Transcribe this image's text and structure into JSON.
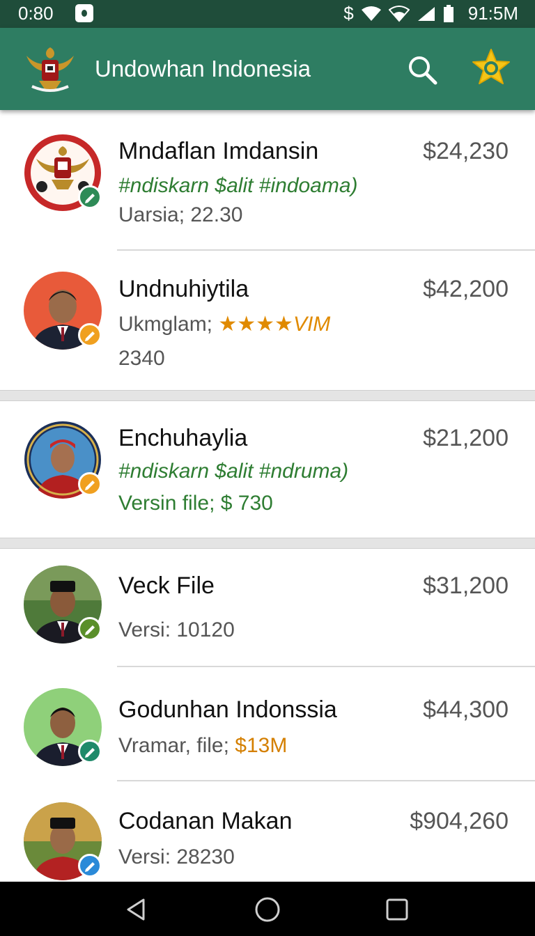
{
  "status_bar": {
    "time": "0:80",
    "dollar_glyph": "$",
    "clock": "91:5M",
    "icons": [
      "notification-icon",
      "dollar-icon",
      "wifi-icon",
      "signal-icon",
      "battery-icon"
    ]
  },
  "app_bar": {
    "title": "Undowhan Indonesia",
    "icons": [
      "garuda-logo-icon",
      "search-icon",
      "star-icon"
    ],
    "colors": {
      "app_bar": "#2e7d62",
      "status_bar": "#1f4d3a",
      "accent_star": "#f5c518"
    }
  },
  "items": [
    {
      "name": "Mndaflan Imdansin",
      "price": "$24,230",
      "line1": "#ndiskarn $alit #indoama)",
      "line2": "Uarsia; 22.30",
      "avatar": "garuda-emblem-avatar",
      "badge": "green-check-badge"
    },
    {
      "name": "Undnuhiytila",
      "price": "$42,200",
      "line1_prefix": "Ukmglam;",
      "line1_rating": "★★★★VIM",
      "line2": "2340",
      "avatar": "official-portrait-avatar",
      "badge": "orange-edit-badge"
    },
    {
      "name": "Enchuhaylia",
      "price": "$21,200",
      "line1": "#ndiskarn $alit #ndruma)",
      "line2": "Versin file; $ 730",
      "avatar": "seal-portrait-avatar",
      "badge": "orange-edit-badge"
    },
    {
      "name": "Veck File",
      "price": "$31,200",
      "line2": "Versi: 10120",
      "avatar": "peci-portrait-avatar",
      "badge": "green-edit-badge"
    },
    {
      "name": "Godunhan Indonssia",
      "price": "$44,300",
      "line2_prefix": "Vramar, file;",
      "line2_value": "$13M",
      "avatar": "green-bg-portrait-avatar",
      "badge": "teal-edit-badge"
    },
    {
      "name": "Codanan Makan",
      "price": "$904,260",
      "line2": "Versi: 28230",
      "avatar": "red-shirt-portrait-avatar",
      "badge": "blue-edit-badge"
    }
  ],
  "nav_bar": {
    "icons": [
      "back-icon",
      "home-icon",
      "recents-icon"
    ]
  }
}
